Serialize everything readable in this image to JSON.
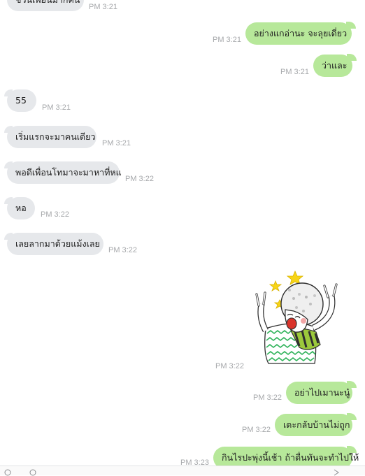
{
  "messages": [
    {
      "side": "in",
      "text": "ชวนเพื่อนมากี่คน",
      "time": "PM 3:21"
    },
    {
      "side": "out",
      "text": "อย่างแกอ่านะ   จะลุยเดี่ยว",
      "time": "PM 3:21"
    },
    {
      "side": "out",
      "text": "ว่าและ",
      "time": "PM 3:21"
    },
    {
      "side": "in",
      "text": "55",
      "time": "PM 3:21"
    },
    {
      "side": "in",
      "text": "เริ่มแรกจะมาคนเดียว",
      "time": "PM 3:21"
    },
    {
      "side": "in",
      "text": "พอดีเพื่อนโทมาจะมาหาที่หแ",
      "time": "PM 3:22"
    },
    {
      "side": "in",
      "text": "หอ",
      "time": "PM 3:22"
    },
    {
      "side": "in",
      "text": "เลยลากมาด้วยแม้งเลย",
      "time": "PM 3:22"
    },
    {
      "side": "out",
      "text": "อย่าไปเมานะนู๋",
      "time": "PM 3:22"
    },
    {
      "side": "out",
      "text": "เดะกลับบ้านไม่ถูก",
      "time": "PM 3:22"
    },
    {
      "side": "out",
      "text": "กินไรปะพุ่งนี้เช้า ถ้าตื่นทันจะทำไปให้",
      "time": "PM 3:23"
    }
  ],
  "sticker": {
    "time": "PM 3:22",
    "icon": "cheering-character-sticker"
  },
  "input_bar": {
    "icons": [
      "emoji-icon",
      "attachment-icon",
      "send-icon"
    ]
  },
  "colors": {
    "incoming": "#e6e8eb",
    "outgoing": "#b7e89a",
    "timestamp": "#a6a8ab"
  }
}
